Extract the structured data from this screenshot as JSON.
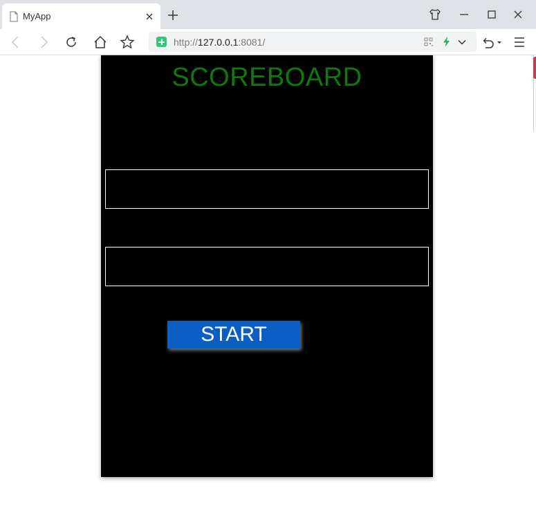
{
  "browser": {
    "tab_title": "MyApp",
    "url_scheme": "http://",
    "url_host": "127.0.0.1",
    "url_rest": ":8081/",
    "icons": [
      "page-icon",
      "close-icon",
      "plus-icon",
      "shirt-icon",
      "minimize-icon",
      "maximize-icon",
      "close-window-icon",
      "back-icon",
      "forward-icon",
      "reload-icon",
      "home-icon",
      "star-icon",
      "shield-plus-icon",
      "qr-icon",
      "lightning-icon",
      "chevron-down-icon",
      "undo-icon",
      "menu-icon"
    ]
  },
  "app": {
    "title": "SCOREBOARD",
    "title_color": "#0e7a0d",
    "background": "#000000",
    "field1": {
      "value": "",
      "placeholder": ""
    },
    "field2": {
      "value": "",
      "placeholder": ""
    },
    "start_label": "START",
    "start_color": "#0b5fc4"
  }
}
